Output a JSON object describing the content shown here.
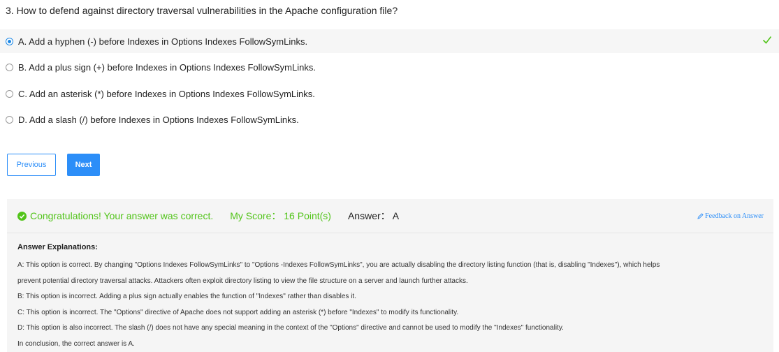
{
  "question": "3. How to defend against directory traversal vulnerabilities in the Apache configuration file?",
  "options": [
    {
      "label": "A. Add a hyphen (-) before Indexes in Options Indexes FollowSymLinks.",
      "selected": true,
      "correct": true
    },
    {
      "label": "B. Add a plus sign (+) before Indexes in Options Indexes FollowSymLinks.",
      "selected": false
    },
    {
      "label": "C. Add an asterisk (*) before Indexes in Options Indexes FollowSymLinks.",
      "selected": false
    },
    {
      "label": "D. Add a slash (/) before Indexes in Options Indexes FollowSymLinks.",
      "selected": false
    }
  ],
  "buttons": {
    "previous": "Previous",
    "next": "Next"
  },
  "result": {
    "congrats": "Congratulations! Your answer was correct.",
    "score": "My Score： 16 Point(s)",
    "answer": "Answer： A",
    "feedback": "Feedback on Answer"
  },
  "explanation": {
    "title": "Answer Explanations:",
    "lines": [
      "A: This option is correct. By changing \"Options Indexes FollowSymLinks\" to \"Options -Indexes FollowSymLinks\", you are actually disabling the directory listing function (that is, disabling \"Indexes\"), which helps",
      "prevent potential directory traversal attacks. Attackers often exploit directory listing to view the file structure on a server and launch further attacks.",
      "B: This option is incorrect. Adding a plus sign actually enables the function of \"Indexes\" rather than disables it.",
      "C: This option is incorrect. The \"Options\" directive of Apache does not support adding an asterisk (*) before \"Indexes\" to modify its functionality.",
      "D: This option is also incorrect. The slash (/) does not have any special meaning in the context of the \"Options\" directive and cannot be used to modify the \"Indexes\" functionality.",
      "In conclusion, the correct answer is A."
    ]
  },
  "colors": {
    "accent": "#2c8ef8",
    "success": "#52c41a"
  }
}
